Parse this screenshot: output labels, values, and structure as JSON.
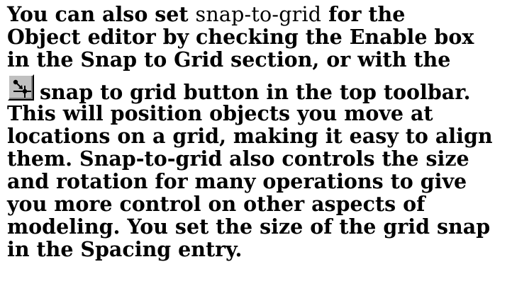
{
  "document": {
    "lines": [
      {
        "before": "You can also set ",
        "mono": "snap-to-grid",
        "after": " for the"
      },
      {
        "text": "Object editor by checking the Enable box"
      },
      {
        "text": "in the Snap to Grid section, or with the"
      },
      {
        "icon": "snap-to-grid-icon",
        "text": "snap to grid button in the top toolbar."
      },
      {
        "text": "This will position objects you move at"
      },
      {
        "text": "locations on a grid, making it easy to align"
      },
      {
        "text": "them. Snap-to-grid also controls the size"
      },
      {
        "text": "and rotation for many operations to give"
      },
      {
        "text": "you more control on other aspects of"
      },
      {
        "text": "modeling. You set the size of the grid snap"
      },
      {
        "text": "in the Spacing entry."
      }
    ]
  },
  "colors": {
    "text": "#000000",
    "background": "#ffffff",
    "icon_face": "#c0c0c0",
    "icon_glyph": "#000000"
  }
}
